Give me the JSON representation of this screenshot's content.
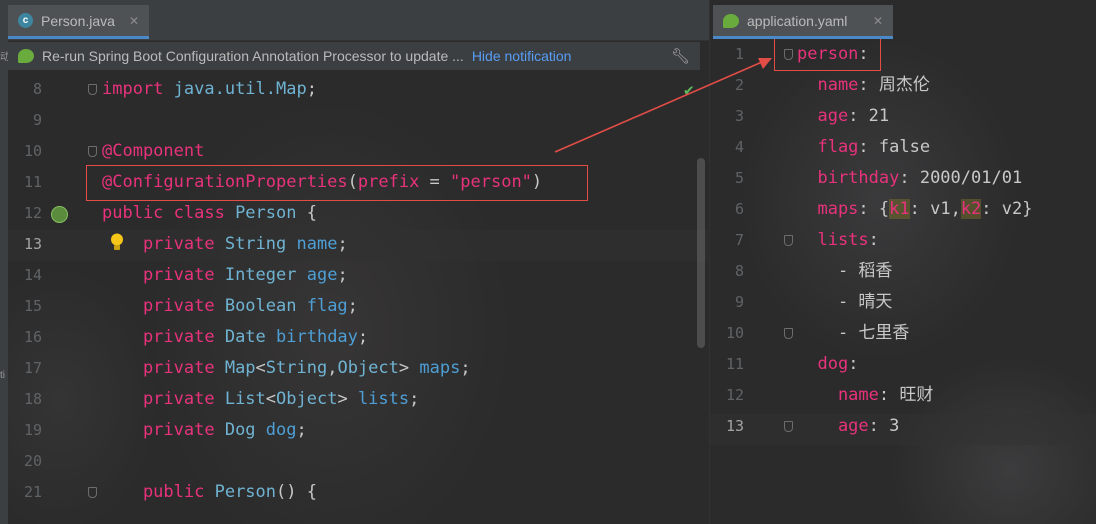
{
  "tabs": {
    "left": {
      "label": "Person.java",
      "close": "✕"
    },
    "right": {
      "label": "application.yaml",
      "close": "✕"
    }
  },
  "notification": {
    "text": "Re-run Spring Boot Configuration Annotation Processor to update ...",
    "link": "Hide notification"
  },
  "side_chars": [
    "动",
    "ti"
  ],
  "java": {
    "line_numbers": [
      "8",
      "9",
      "10",
      "11",
      "12",
      "13",
      "14",
      "15",
      "16",
      "17",
      "18",
      "19",
      "20",
      "21"
    ],
    "lines": [
      [
        {
          "t": "import ",
          "c": "kw2"
        },
        {
          "t": "java.util.Map",
          "c": "typ"
        },
        {
          "t": ";",
          "c": "pln"
        }
      ],
      [],
      [
        {
          "t": "@Component",
          "c": "kw2"
        }
      ],
      [
        {
          "t": "@ConfigurationProperties",
          "c": "kw2"
        },
        {
          "t": "(",
          "c": "pln"
        },
        {
          "t": "prefix",
          "c": "kw2"
        },
        {
          "t": " = ",
          "c": "pln"
        },
        {
          "t": "\"person\"",
          "c": "kw2"
        },
        {
          "t": ")",
          "c": "pln"
        }
      ],
      [
        {
          "t": "public class ",
          "c": "kw2"
        },
        {
          "t": "Person",
          "c": "typ"
        },
        {
          "t": " {",
          "c": "pln"
        }
      ],
      [
        {
          "t": "    private ",
          "c": "kw2"
        },
        {
          "t": "String ",
          "c": "typ"
        },
        {
          "t": "name",
          "c": "fld"
        },
        {
          "t": ";",
          "c": "pln"
        }
      ],
      [
        {
          "t": "    private ",
          "c": "kw2"
        },
        {
          "t": "Integer ",
          "c": "typ"
        },
        {
          "t": "age",
          "c": "fld"
        },
        {
          "t": ";",
          "c": "pln"
        }
      ],
      [
        {
          "t": "    private ",
          "c": "kw2"
        },
        {
          "t": "Boolean ",
          "c": "typ"
        },
        {
          "t": "flag",
          "c": "fld"
        },
        {
          "t": ";",
          "c": "pln"
        }
      ],
      [
        {
          "t": "    private ",
          "c": "kw2"
        },
        {
          "t": "Date ",
          "c": "typ"
        },
        {
          "t": "birthday",
          "c": "fld"
        },
        {
          "t": ";",
          "c": "pln"
        }
      ],
      [
        {
          "t": "    private ",
          "c": "kw2"
        },
        {
          "t": "Map",
          "c": "typ"
        },
        {
          "t": "<",
          "c": "pln"
        },
        {
          "t": "String",
          "c": "typ"
        },
        {
          "t": ",",
          "c": "pln"
        },
        {
          "t": "Object",
          "c": "typ"
        },
        {
          "t": "> ",
          "c": "pln"
        },
        {
          "t": "maps",
          "c": "fld"
        },
        {
          "t": ";",
          "c": "pln"
        }
      ],
      [
        {
          "t": "    private ",
          "c": "kw2"
        },
        {
          "t": "List",
          "c": "typ"
        },
        {
          "t": "<",
          "c": "pln"
        },
        {
          "t": "Object",
          "c": "typ"
        },
        {
          "t": "> ",
          "c": "pln"
        },
        {
          "t": "lists",
          "c": "fld"
        },
        {
          "t": ";",
          "c": "pln"
        }
      ],
      [
        {
          "t": "    private ",
          "c": "kw2"
        },
        {
          "t": "Dog ",
          "c": "typ"
        },
        {
          "t": "dog",
          "c": "fld"
        },
        {
          "t": ";",
          "c": "pln"
        }
      ],
      [],
      [
        {
          "t": "    public ",
          "c": "kw2"
        },
        {
          "t": "Person",
          "c": "typ"
        },
        {
          "t": "() {",
          "c": "pln"
        }
      ]
    ]
  },
  "yaml": {
    "line_numbers": [
      "1",
      "2",
      "3",
      "4",
      "5",
      "6",
      "7",
      "8",
      "9",
      "10",
      "11",
      "12",
      "13"
    ],
    "lines": [
      [
        {
          "t": "person",
          "c": "ykey"
        },
        {
          "t": ":",
          "c": "yval"
        }
      ],
      [
        {
          "t": "  name",
          "c": "ykey"
        },
        {
          "t": ": 周杰伦",
          "c": "yval"
        }
      ],
      [
        {
          "t": "  age",
          "c": "ykey"
        },
        {
          "t": ": 21",
          "c": "yval"
        }
      ],
      [
        {
          "t": "  flag",
          "c": "ykey"
        },
        {
          "t": ": false",
          "c": "yval"
        }
      ],
      [
        {
          "t": "  birthday",
          "c": "ykey"
        },
        {
          "t": ": 2000/01/01",
          "c": "yval"
        }
      ],
      [
        {
          "t": "  maps",
          "c": "ykey"
        },
        {
          "t": ": {",
          "c": "yval"
        },
        {
          "t": "k1",
          "c": "ykeyhl"
        },
        {
          "t": ": v1,",
          "c": "yval"
        },
        {
          "t": "k2",
          "c": "ykeyhl"
        },
        {
          "t": ": v2}",
          "c": "yval"
        }
      ],
      [
        {
          "t": "  lists",
          "c": "ykey"
        },
        {
          "t": ":",
          "c": "yval"
        }
      ],
      [
        {
          "t": "    - 稻香",
          "c": "yval"
        }
      ],
      [
        {
          "t": "    - 晴天",
          "c": "yval"
        }
      ],
      [
        {
          "t": "    - 七里香",
          "c": "yval"
        }
      ],
      [
        {
          "t": "  dog",
          "c": "ykey"
        },
        {
          "t": ":",
          "c": "yval"
        }
      ],
      [
        {
          "t": "    name",
          "c": "ykey"
        },
        {
          "t": ": 旺财",
          "c": "yval"
        }
      ],
      [
        {
          "t": "    age",
          "c": "ykey"
        },
        {
          "t": ": 3",
          "c": "yval"
        }
      ]
    ]
  },
  "icons": {
    "check": "check-icon",
    "bulb": "lightbulb-icon",
    "bean": "spring-bean-icon",
    "wrench": "wrench-icon"
  },
  "colors": {
    "keyword": "#e8327c",
    "type": "#6fb3d2",
    "field": "#4d9fd6",
    "annotation_box": "#e24d47",
    "link": "#589df6"
  }
}
